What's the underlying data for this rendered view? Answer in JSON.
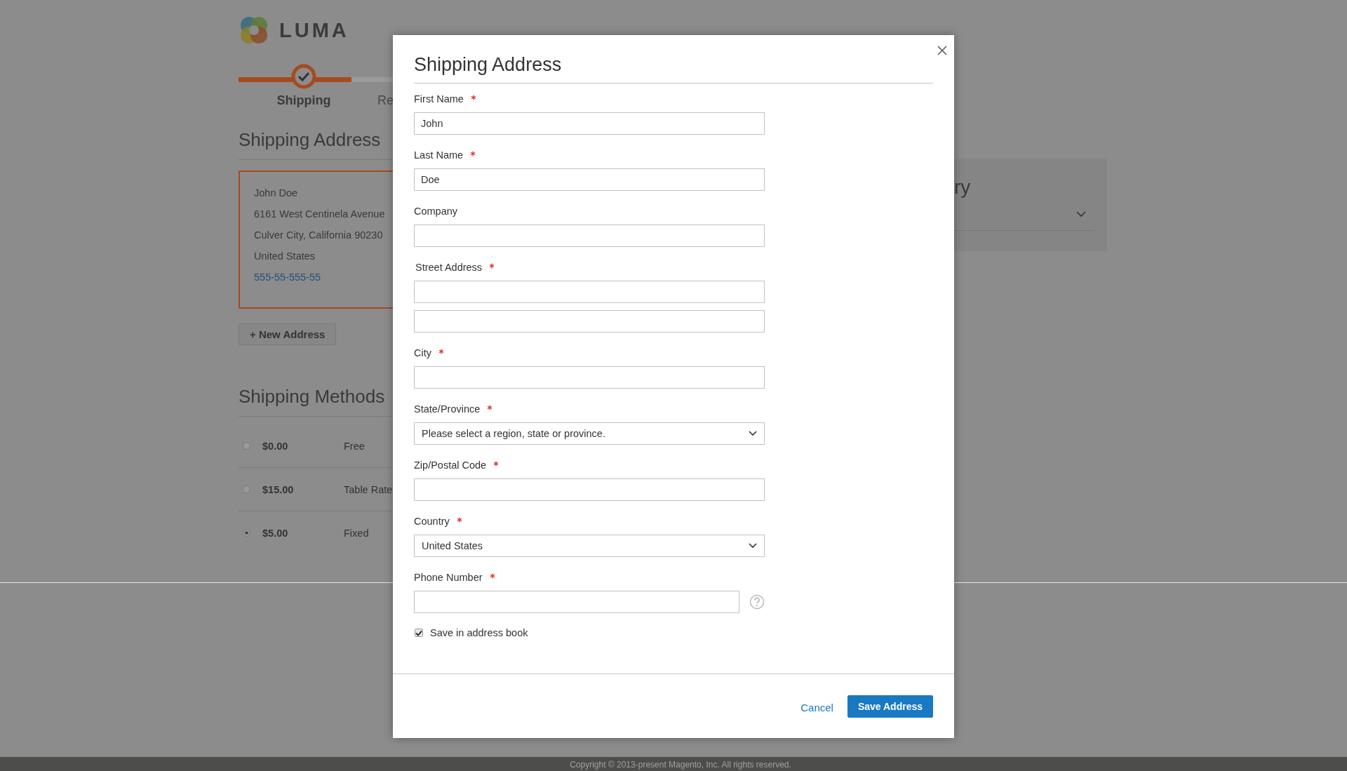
{
  "logo": {
    "text": "LUMA"
  },
  "progress": {
    "steps": [
      {
        "label": "Shipping",
        "selected": true
      },
      {
        "label": "Re",
        "selected": false
      }
    ]
  },
  "shipping_address": {
    "title": "Shipping Address",
    "card": {
      "selected": true,
      "lines": [
        "John Doe",
        "6161 West Centinela Avenue",
        "Culver City, California 90230",
        "United States"
      ],
      "phone": "555-55-555-55"
    },
    "new_address_button": "+ New Address"
  },
  "shipping_methods": {
    "title": "Shipping Methods",
    "rows": [
      {
        "price": "$0.00",
        "label": "Free",
        "selected": false
      },
      {
        "price": "$15.00",
        "label": "Table Rate",
        "selected": false
      },
      {
        "price": "$5.00",
        "label": "Fixed",
        "selected": true
      }
    ]
  },
  "summary": {
    "title": "ry"
  },
  "modal": {
    "title": "Shipping Address",
    "fields": [
      {
        "kind": "text",
        "label": "First Name",
        "required": true,
        "value": "John"
      },
      {
        "kind": "text",
        "label": "Last Name",
        "required": true,
        "value": "Doe"
      },
      {
        "kind": "text",
        "label": "Company",
        "required": false
      },
      {
        "kind": "street",
        "label": "Street Address",
        "required": true
      },
      {
        "kind": "text",
        "label": "City",
        "required": true
      },
      {
        "kind": "select",
        "label": "State/Province",
        "required": true,
        "value": "Please select a region, state or province."
      },
      {
        "kind": "text",
        "label": "Zip/Postal Code",
        "required": true
      },
      {
        "kind": "select",
        "label": "Country",
        "required": true,
        "value": "United States"
      },
      {
        "kind": "phone",
        "label": "Phone Number",
        "required": true
      }
    ],
    "save_in_address_book": {
      "label": "Save in address book",
      "checked": true
    },
    "cancel": "Cancel",
    "save": "Save Address"
  },
  "footer": {
    "copyright": "Copyright © 2013-present Magento, Inc. All rights reserved."
  }
}
